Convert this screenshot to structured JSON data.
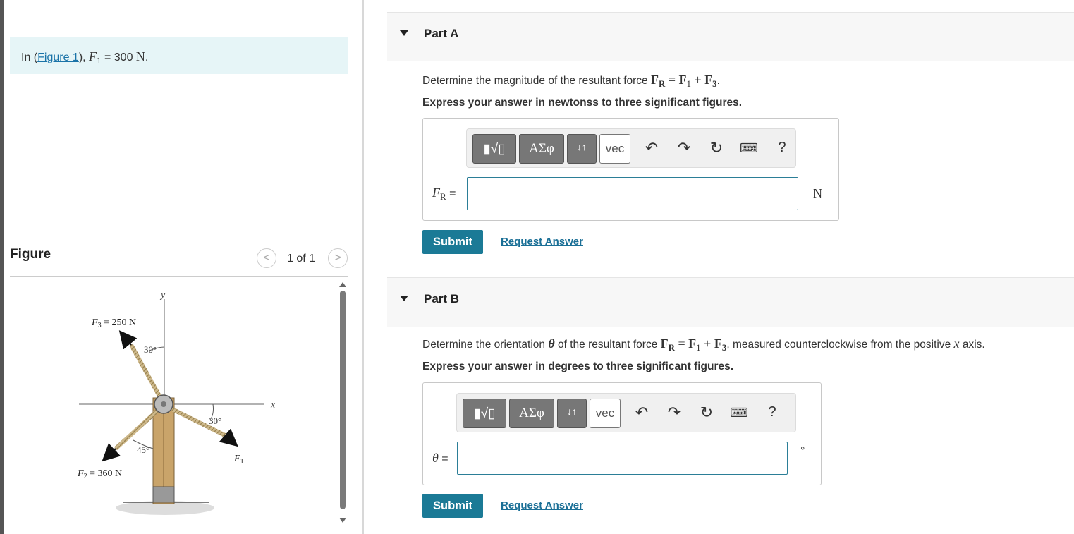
{
  "intro": {
    "prefix": "In (",
    "figure_link": "Figure 1",
    "suffix": "), ",
    "var": "F",
    "var_sub": "1",
    "eq": " = 300 ",
    "unit": "N",
    "end": "."
  },
  "figure_panel": {
    "title": "Figure",
    "count": "1 of 1",
    "prev_symbol": "<",
    "next_symbol": ">"
  },
  "diagram": {
    "y_axis": "y",
    "x_axis": "x",
    "f3_label": "F",
    "f3_sub": "3",
    "f3_value": " = 250 N",
    "f2_label": "F",
    "f2_sub": "2",
    "f2_value": " = 360 N",
    "f1_label": "F",
    "f1_sub": "1",
    "angle_f3": "30°",
    "angle_f1": "30°",
    "angle_f2": "45°"
  },
  "toolbar": {
    "templates_label": "▮√▯",
    "greek_label": "ΑΣφ",
    "arrows_label": "↓↑",
    "vec_label": "vec",
    "help_label": "?"
  },
  "part_a": {
    "title": "Part A",
    "question_prefix": "Determine the magnitude of the resultant force ",
    "F": "F",
    "R": "R",
    "eq": " = ",
    "one": "1",
    "plus": " + ",
    "three": "3",
    "question_end": ".",
    "instruction": "Express your answer in newtonss to three significant figures.",
    "answer_var": "F",
    "answer_sub": "R",
    "answer_eq": " =",
    "answer_value": "",
    "unit": "N",
    "submit": "Submit",
    "request": "Request Answer"
  },
  "part_b": {
    "title": "Part B",
    "question_prefix": "Determine the orientation ",
    "theta": "θ",
    "question_mid": " of the resultant force ",
    "F": "F",
    "R": "R",
    "eq": " = ",
    "one": "1",
    "plus": " + ",
    "three": "3",
    "question_suffix": ", measured counterclockwise from the positive ",
    "x": "x",
    "question_end": " axis.",
    "instruction": "Express your answer in degrees to three significant figures.",
    "answer_var": "θ",
    "answer_eq": " =",
    "answer_value": "",
    "unit": "°",
    "submit": "Submit",
    "request": "Request Answer"
  },
  "colors": {
    "accent": "#1b7a96",
    "link": "#1a73a8",
    "intro_bg": "#e6f5f7",
    "post_wood": "#c9a46a"
  }
}
